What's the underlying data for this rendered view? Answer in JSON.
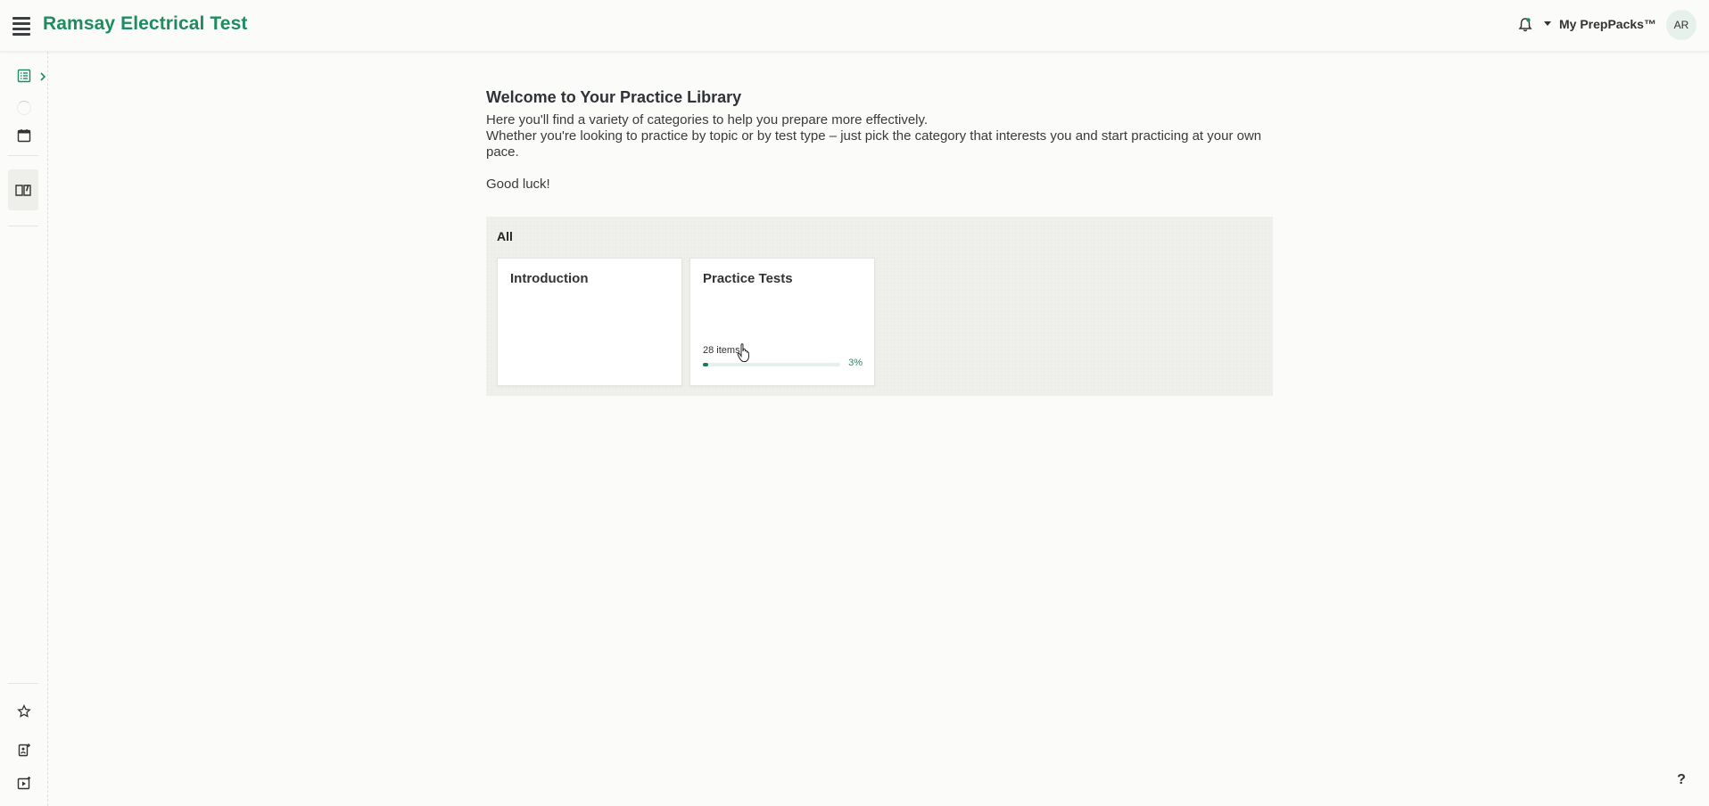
{
  "header": {
    "app_title": "Ramsay Electrical Test",
    "account_menu_label": "My PrepPacks™",
    "avatar_initials": "AR"
  },
  "main": {
    "title": "Welcome to Your Practice Library",
    "intro_line1": "Here you'll find a variety of categories to help you prepare more effectively.",
    "intro_line2": "Whether you're looking to practice by topic or by test type – just pick the category that interests you and start practicing at your own pace.",
    "closing": "Good luck!",
    "category_group_label": "All",
    "cards": [
      {
        "title": "Introduction"
      },
      {
        "title": "Practice Tests",
        "count_label": "28 items",
        "progress_label": "3%",
        "progress_fraction": 0.03
      }
    ]
  },
  "help_label": "?",
  "colors": {
    "brand": "#1e8c63",
    "progress": "#1e7a55",
    "background": "#fbfbf9"
  },
  "icons": [
    "menu-icon",
    "bell-icon",
    "caret-down-icon",
    "list-icon",
    "chevron-right-icon",
    "calendar-icon",
    "book-icon",
    "star-icon",
    "document-add-icon",
    "video-icon",
    "cursor-icon"
  ]
}
